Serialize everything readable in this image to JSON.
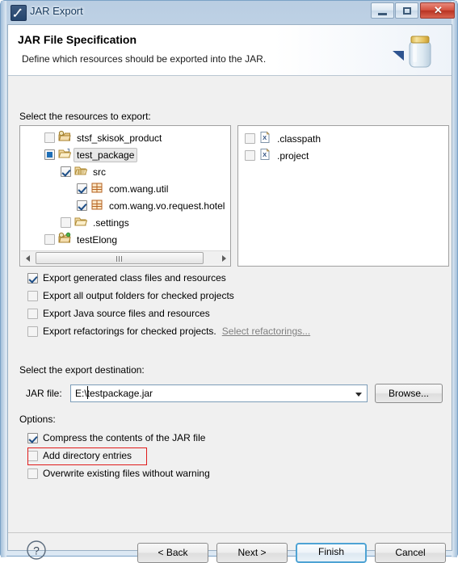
{
  "window": {
    "title": "JAR Export",
    "icon": "jar-export-icon",
    "minimize_label": "–",
    "maximize_label": "□",
    "close_label": "✕"
  },
  "banner": {
    "title": "JAR File Specification",
    "subtitle": "Define which resources should be exported into the JAR.",
    "icon": "jar-jar-icon",
    "arrow": "blue-triangle-icon"
  },
  "resources": {
    "label": "Select the resources to export:",
    "tree": [
      {
        "label": "stsf_skisok_product",
        "state": "unchecked",
        "icon": "java-project-icon",
        "indent": 0,
        "selected": false
      },
      {
        "label": "test_package",
        "state": "grayed",
        "icon": "open-folder-project-icon",
        "indent": 0,
        "selected": true
      },
      {
        "label": "src",
        "state": "checked",
        "icon": "source-folder-icon",
        "indent": 1,
        "selected": false
      },
      {
        "label": "com.wang.util",
        "state": "checked",
        "icon": "package-icon",
        "indent": 2,
        "selected": false
      },
      {
        "label": "com.wang.vo.request.hotel",
        "state": "checked",
        "icon": "package-icon",
        "indent": 2,
        "selected": false
      },
      {
        "label": ".settings",
        "state": "unchecked",
        "icon": "folder-icon",
        "indent": 1,
        "selected": false
      },
      {
        "label": "testElong",
        "state": "unchecked",
        "icon": "java-project-icon",
        "indent": 0,
        "selected": false
      }
    ],
    "files": [
      {
        "label": ".classpath",
        "state": "unchecked",
        "icon": "xml-file-icon"
      },
      {
        "label": ".project",
        "state": "unchecked",
        "icon": "xml-file-icon"
      }
    ]
  },
  "export_options": [
    {
      "label": "Export generated class files and resources",
      "state": "checked"
    },
    {
      "label": "Export all output folders for checked projects",
      "state": "unchecked"
    },
    {
      "label": "Export Java source files and resources",
      "state": "unchecked"
    },
    {
      "label": "Export refactorings for checked projects.",
      "state": "unchecked",
      "link": "Select refactorings..."
    }
  ],
  "destination": {
    "label": "Select the export destination:",
    "field_label": "JAR file:",
    "value": "E:\\testpackage.jar",
    "placeholder": "",
    "browse_label": "Browse..."
  },
  "options": {
    "label": "Options:",
    "items": [
      {
        "label": "Compress the contents of the JAR file",
        "state": "checked",
        "highlighted": false
      },
      {
        "label": "Add directory entries",
        "state": "unchecked",
        "highlighted": true
      },
      {
        "label": "Overwrite existing files without warning",
        "state": "unchecked",
        "highlighted": false
      }
    ]
  },
  "footer": {
    "help_label": "?",
    "back_label": "< Back",
    "next_label": "Next >",
    "finish_label": "Finish",
    "cancel_label": "Cancel"
  },
  "colors": {
    "accent": "#4ea3d4",
    "highlight": "#e01b1b",
    "checkbox_check": "#1c4d86",
    "title_text": "#15385c"
  }
}
